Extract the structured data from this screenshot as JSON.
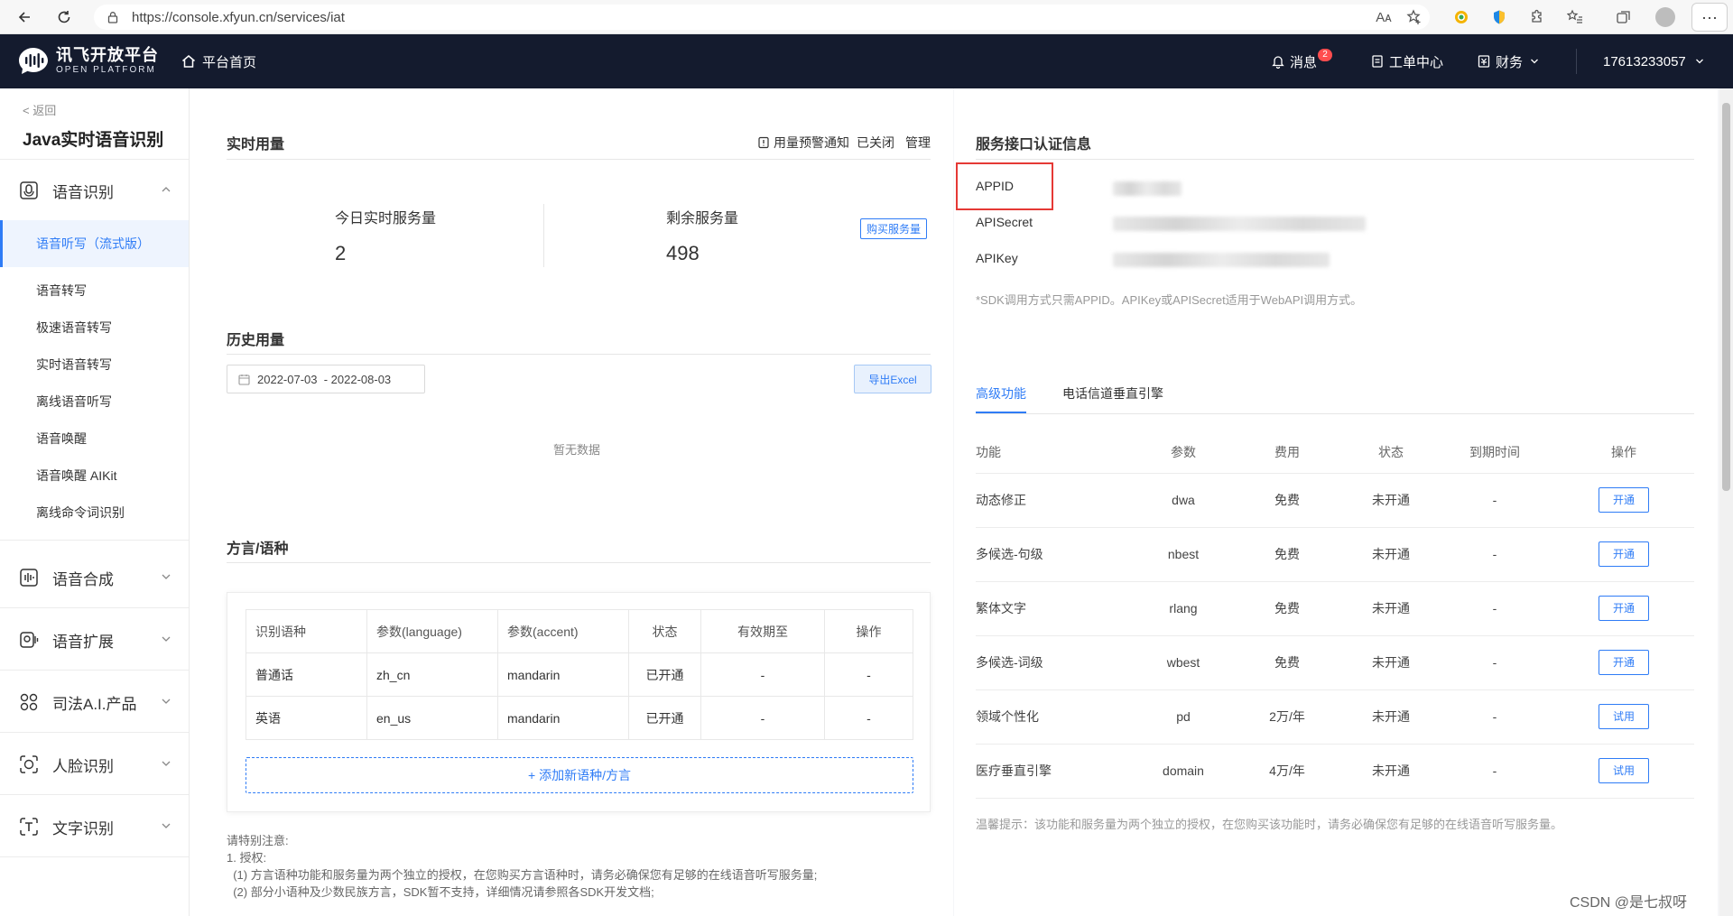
{
  "browser": {
    "url": "https://console.xfyun.cn/services/iat",
    "reader_icon": "Aᴀ"
  },
  "header": {
    "logo_cn": "讯飞开放平台",
    "logo_en": "OPEN PLATFORM",
    "home": "平台首页",
    "messages": "消息",
    "messages_badge": "2",
    "tickets": "工单中心",
    "finance": "财务",
    "account": "17613233057"
  },
  "sidebar": {
    "back": "< 返回",
    "service_title": "Java实时语音识别",
    "groups": [
      {
        "label": "语音识别",
        "icon": "speech-recognition-icon"
      },
      {
        "label": "语音合成",
        "icon": "speech-synthesis-icon"
      },
      {
        "label": "语音扩展",
        "icon": "speech-extension-icon"
      },
      {
        "label": "司法A.I.产品",
        "icon": "judicial-ai-icon"
      },
      {
        "label": "人脸识别",
        "icon": "face-recognition-icon"
      },
      {
        "label": "文字识别",
        "icon": "text-recognition-icon"
      }
    ],
    "items": [
      "语音听写（流式版）",
      "语音转写",
      "极速语音转写",
      "实时语音转写",
      "离线语音听写",
      "语音唤醒",
      "语音唤醒 AIKit",
      "离线命令词识别"
    ]
  },
  "usage": {
    "title": "实时用量",
    "alert_label": "用量预警通知",
    "alert_status": "已关闭",
    "manage": "管理",
    "today_label": "今日实时服务量",
    "today_value": "2",
    "remaining_label": "剩余服务量",
    "remaining_value": "498",
    "buy": "购买服务量"
  },
  "history": {
    "title": "历史用量",
    "date_range": "2022-07-03  - 2022-08-03",
    "export": "导出Excel",
    "empty": "暂无数据"
  },
  "dialect": {
    "title": "方言/语种",
    "columns": [
      "识别语种",
      "参数(language)",
      "参数(accent)",
      "状态",
      "有效期至",
      "操作"
    ],
    "rows": [
      [
        "普通话",
        "zh_cn",
        "mandarin",
        "已开通",
        "-",
        "-"
      ],
      [
        "英语",
        "en_us",
        "mandarin",
        "已开通",
        "-",
        "-"
      ]
    ],
    "add": "+ 添加新语种/方言",
    "notes": [
      "请特别注意:",
      "1. 授权:",
      "  (1) 方言语种功能和服务量为两个独立的授权，在您购买方言语种时，请务必确保您有足够的在线语音听写服务量;",
      "  (2) 部分小语种及少数民族方言，SDK暂不支持，详细情况请参照各SDK开发文档;"
    ]
  },
  "auth": {
    "title": "服务接口认证信息",
    "labels": [
      "APPID",
      "APISecret",
      "APIKey"
    ],
    "sdk_note": "*SDK调用方式只需APPID。APIKey或APISecret适用于WebAPI调用方式。"
  },
  "advanced": {
    "tabs": [
      "高级功能",
      "电话信道垂直引擎"
    ],
    "columns": [
      "功能",
      "参数",
      "费用",
      "状态",
      "到期时间",
      "操作"
    ],
    "rows": [
      [
        "动态修正",
        "dwa",
        "免费",
        "未开通",
        "-",
        "开通"
      ],
      [
        "多候选-句级",
        "nbest",
        "免费",
        "未开通",
        "-",
        "开通"
      ],
      [
        "繁体文字",
        "rlang",
        "免费",
        "未开通",
        "-",
        "开通"
      ],
      [
        "多候选-词级",
        "wbest",
        "免费",
        "未开通",
        "-",
        "开通"
      ],
      [
        "领域个性化",
        "pd",
        "2万/年",
        "未开通",
        "-",
        "试用"
      ],
      [
        "医疗垂直引擎",
        "domain",
        "4万/年",
        "未开通",
        "-",
        "试用"
      ]
    ],
    "tip": "温馨提示：该功能和服务量为两个独立的授权，在您购买该功能时，请务必确保您有足够的在线语音听写服务量。"
  },
  "watermark": "CSDN @是七叔呀",
  "colors": {
    "header_bg": "#141b2e",
    "accent": "#2f7cf6",
    "highlight": "#e53935"
  }
}
